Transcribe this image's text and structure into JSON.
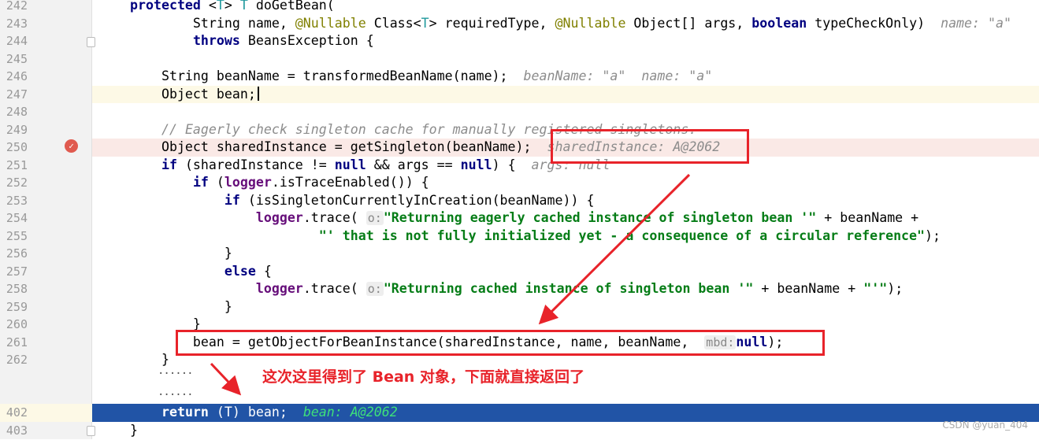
{
  "editor": {
    "lines": [
      {
        "n": "242",
        "toks": [
          [
            "protected",
            "kw"
          ],
          " <",
          [
            "T",
            "tp"
          ],
          "> ",
          [
            "T",
            "tp"
          ],
          " doGetBean("
        ]
      },
      {
        "n": "243",
        "toks": [
          "        String name, ",
          [
            "@Nullable",
            "ann"
          ],
          " Class<",
          [
            "T",
            "tp"
          ],
          "> requiredType, ",
          [
            "@Nullable",
            "ann"
          ],
          " Object[] args, ",
          [
            "boolean",
            "kw"
          ],
          " typeCheckOnly)  ",
          [
            "name: \"a\"",
            "hint"
          ]
        ]
      },
      {
        "n": "244",
        "toks": [
          "        ",
          [
            "throws",
            "kw"
          ],
          " BeansException {"
        ]
      },
      {
        "n": "245",
        "toks": []
      },
      {
        "n": "246",
        "hl": "yellow0",
        "toks": [
          "    String beanName = transformedBeanName(name);  ",
          [
            "beanName: \"a\"  name: \"a\"",
            "hint"
          ]
        ]
      },
      {
        "n": "247",
        "hl": "yellow",
        "toks": [
          "    Object bean;"
        ]
      },
      {
        "n": "248",
        "toks": []
      },
      {
        "n": "249",
        "toks": [
          "    ",
          [
            "// Eagerly check singleton cache for manually registered singletons.",
            "cmt"
          ]
        ]
      },
      {
        "n": "250",
        "hl": "red",
        "toks": [
          "    Object sharedInstance = getSingleton(beanName);  ",
          [
            "sharedInstance: A@2062",
            "hint"
          ]
        ]
      },
      {
        "n": "251",
        "toks": [
          "    ",
          [
            "if",
            "kw"
          ],
          " (sharedInstance != ",
          [
            "null",
            "kw"
          ],
          " && args == ",
          [
            "null",
            "kw"
          ],
          ") {  ",
          [
            "args: null",
            "hint"
          ]
        ]
      },
      {
        "n": "252",
        "toks": [
          "        ",
          [
            "if",
            "kw"
          ],
          " (",
          [
            "logger",
            "log"
          ],
          ".isTraceEnabled()) {"
        ]
      },
      {
        "n": "253",
        "toks": [
          "            ",
          [
            "if",
            "kw"
          ],
          " (isSingletonCurrentlyInCreation(beanName)) {"
        ]
      },
      {
        "n": "254",
        "toks": [
          "                ",
          [
            "logger",
            "log"
          ],
          ".trace( ",
          [
            "o:",
            "ph"
          ],
          [
            "\"Returning eagerly cached instance of singleton bean '\"",
            "str"
          ],
          " + beanName +"
        ]
      },
      {
        "n": "255",
        "toks": [
          "                        ",
          [
            "\"' that is not fully initialized yet - a consequence of a circular reference\"",
            "str"
          ],
          ");"
        ]
      },
      {
        "n": "256",
        "toks": [
          "            }"
        ]
      },
      {
        "n": "257",
        "toks": [
          "            ",
          [
            "else",
            "kw"
          ],
          " {"
        ]
      },
      {
        "n": "258",
        "toks": [
          "                ",
          [
            "logger",
            "log"
          ],
          ".trace( ",
          [
            "o:",
            "ph"
          ],
          [
            "\"Returning cached instance of singleton bean '\"",
            "str"
          ],
          " + beanName + ",
          [
            "\"'\"",
            "str"
          ],
          ");"
        ]
      },
      {
        "n": "259",
        "toks": [
          "            }"
        ]
      },
      {
        "n": "260",
        "toks": [
          "        }"
        ]
      },
      {
        "n": "261",
        "toks": [
          "        bean = getObjectForBeanInstance(sharedInstance, name, beanName,  ",
          [
            "mbd:",
            "ph"
          ],
          [
            "null",
            "kw"
          ],
          ");"
        ]
      },
      {
        "n": "262",
        "toks": [
          "    }"
        ]
      },
      {
        "n": "402",
        "hl": "blue",
        "toks": [
          "    ",
          [
            "return",
            "kw"
          ],
          " (T) bean;  ",
          [
            "bean: A@2062",
            "hint"
          ]
        ]
      },
      {
        "n": "403",
        "toks": [
          "}"
        ]
      }
    ],
    "ellipsis_1": "......",
    "ellipsis_2": "......"
  },
  "annotation": {
    "text": "这次这里得到了 Bean 对象，下面就直接返回了",
    "color": "#e8232a"
  },
  "watermark": "CSDN @yuan_404",
  "colors": {
    "execution_line": "#2154a6",
    "breakpoint_line": "#fae9e6",
    "annotation_red": "#e8232a"
  }
}
